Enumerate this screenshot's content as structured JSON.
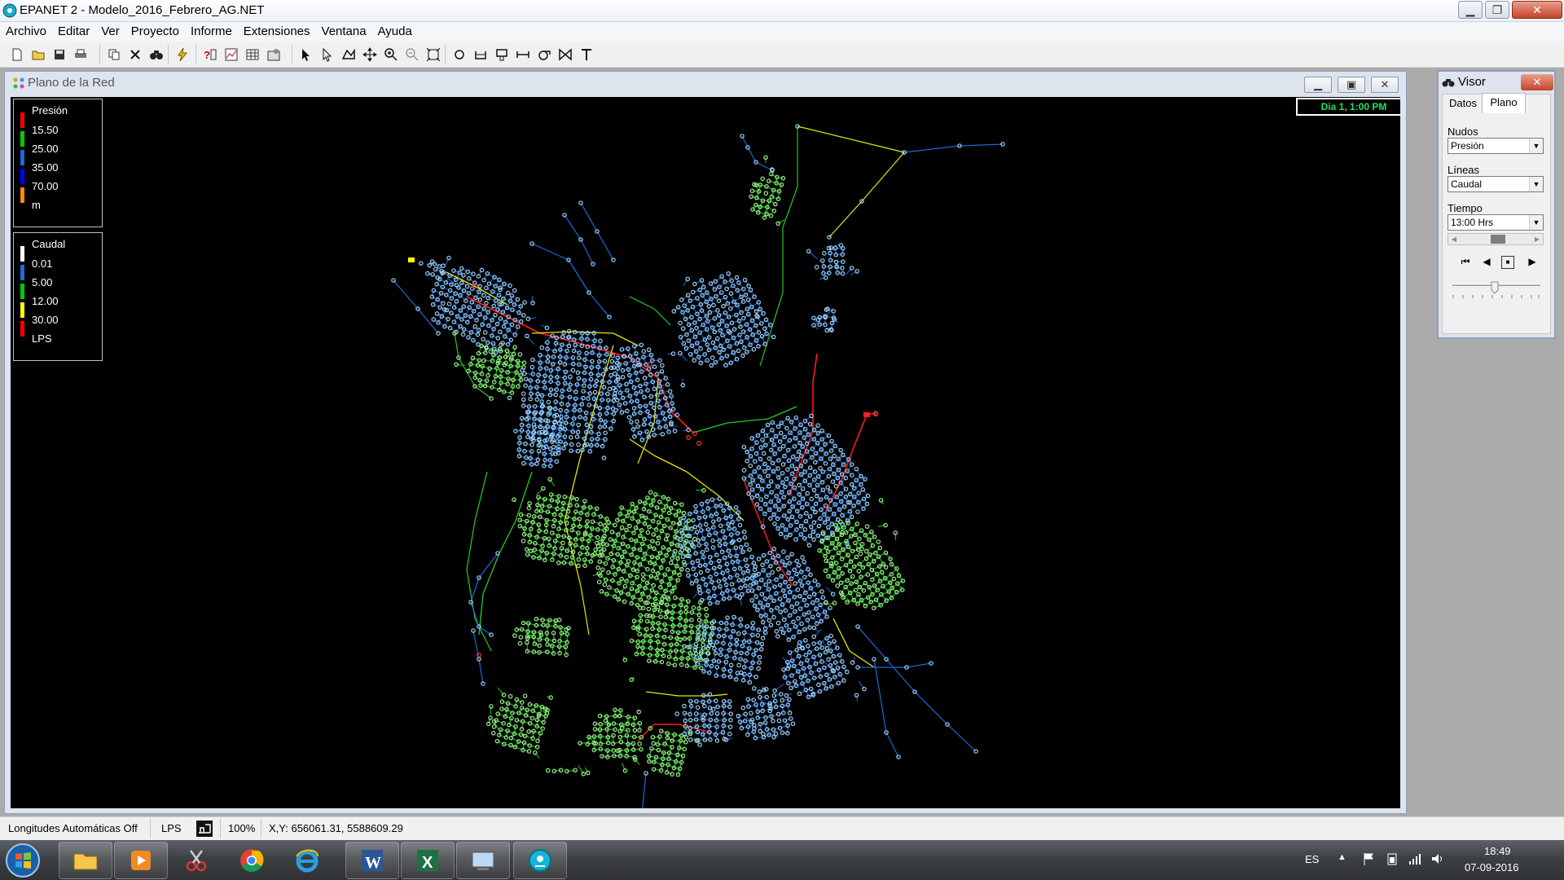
{
  "window": {
    "title": "EPANET 2 - Modelo_2016_Febrero_AG.NET"
  },
  "menu": [
    "Archivo",
    "Editar",
    "Ver",
    "Proyecto",
    "Informe",
    "Extensiones",
    "Ventana",
    "Ayuda"
  ],
  "toolbar": {
    "file_icons": [
      "new-file-icon",
      "open-folder-icon",
      "save-icon",
      "print-icon"
    ],
    "edit_icons": [
      "copy-icon",
      "delete-icon",
      "find-icon"
    ],
    "run_icons": [
      "run-analysis-icon"
    ],
    "report_icons": [
      "query-icon",
      "graph-icon",
      "table-icon",
      "options-icon"
    ],
    "map_icons": [
      "select-object-icon",
      "select-vertex-icon",
      "select-region-icon",
      "pan-icon",
      "zoom-in-icon",
      "zoom-out-icon",
      "full-extent-icon"
    ],
    "object_icons": [
      "add-junction-icon",
      "add-reservoir-icon",
      "add-tank-icon",
      "add-pipe-icon",
      "add-pump-icon",
      "add-valve-icon",
      "add-label-icon"
    ]
  },
  "network_window": {
    "title": "Plano de la Red",
    "time_badge": "Dia 1, 1:00 PM",
    "node_legend": {
      "title": "Presión",
      "entries": [
        {
          "label": "15.50",
          "color": "#ff0000"
        },
        {
          "label": "25.00",
          "color": "#00cc00"
        },
        {
          "label": "35.00",
          "color": "#1e6ad6"
        },
        {
          "label": "70.00",
          "color": "#0000ff"
        },
        {
          "label": "m",
          "color": "#ff8800"
        }
      ]
    },
    "link_legend": {
      "title": "Caudal",
      "entries": [
        {
          "label": "0.01",
          "color": "#ffffff"
        },
        {
          "label": "5.00",
          "color": "#1e6ad6"
        },
        {
          "label": "12.00",
          "color": "#00cc00"
        },
        {
          "label": "30.00",
          "color": "#ffff00"
        },
        {
          "label": "LPS",
          "color": "#ff0000"
        }
      ]
    }
  },
  "visor": {
    "title": "Visor",
    "tabs": [
      "Datos",
      "Plano"
    ],
    "active_tab": "Plano",
    "nodes_label": "Nudos",
    "nodes_value": "Presión",
    "links_label": "Líneas",
    "links_value": "Caudal",
    "time_label": "Tiempo",
    "time_value": "13:00 Hrs"
  },
  "status": {
    "auto_length": "Longitudes Automáticas Off",
    "flow_units": "LPS",
    "zoom": "100%",
    "coords": "X,Y: 656061.31, 5588609.29"
  },
  "taskbar": {
    "apps": [
      "file-explorer-icon",
      "media-player-icon",
      "snipping-tool-icon",
      "chrome-icon",
      "internet-explorer-icon",
      "word-icon",
      "excel-icon",
      "remote-desktop-icon",
      "epanet-icon"
    ],
    "language": "ES",
    "time": "18:49",
    "date": "07-09-2016"
  },
  "colors": {
    "pipe_blue": "#1e6ad6",
    "pipe_green": "#22cc22",
    "pipe_yellow": "#e8e800",
    "pipe_red": "#ff1a1a",
    "node_blue": "#9dd0f4",
    "node_green": "#9cf28a"
  }
}
